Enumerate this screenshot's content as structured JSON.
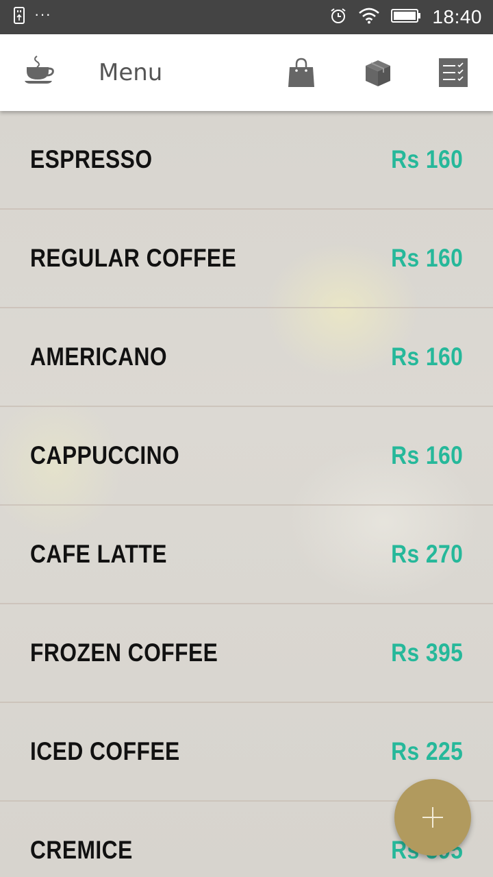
{
  "status_bar": {
    "time": "18:40",
    "dots": "···"
  },
  "app_bar": {
    "title": "Menu"
  },
  "menu": {
    "items": [
      {
        "name": "ESPRESSO",
        "price": "Rs 160"
      },
      {
        "name": "REGULAR COFFEE",
        "price": "Rs 160"
      },
      {
        "name": "AMERICANO",
        "price": "Rs 160"
      },
      {
        "name": "CAPPUCCINO",
        "price": "Rs 160"
      },
      {
        "name": "CAFE LATTE",
        "price": "Rs 270"
      },
      {
        "name": "FROZEN COFFEE",
        "price": "Rs 395"
      },
      {
        "name": "ICED COFFEE",
        "price": "Rs 225"
      },
      {
        "name": "CREMICE",
        "price": "Rs 395"
      }
    ]
  },
  "icons": {
    "status": [
      "usb-icon",
      "alarm-icon",
      "wifi-icon",
      "battery-icon"
    ],
    "app_bar": [
      "coffee-cup-icon",
      "shopping-bag-icon",
      "package-box-icon",
      "checklist-icon"
    ],
    "fab": "plus-icon"
  },
  "colors": {
    "price": "#26b89a",
    "fab": "#b19a5e",
    "status_bar": "#444444"
  }
}
